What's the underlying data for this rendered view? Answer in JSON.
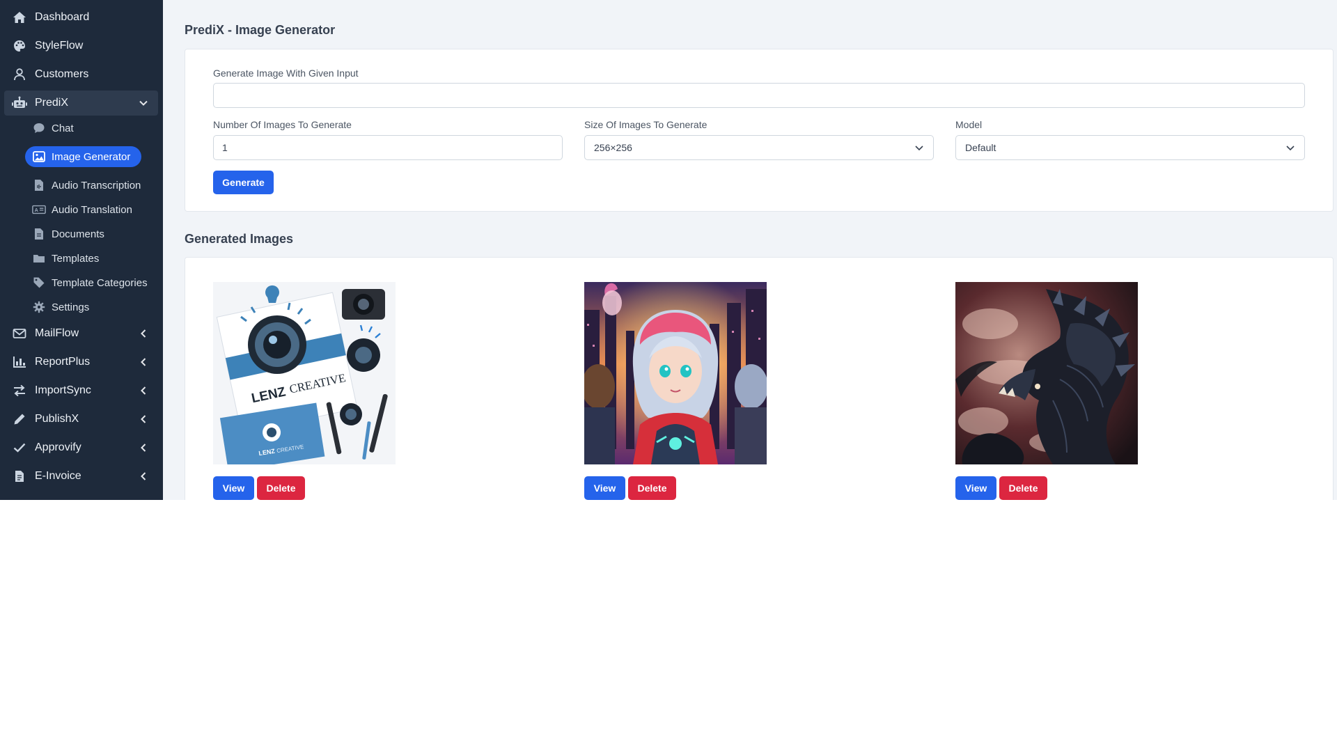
{
  "sidebar": {
    "top_items": [
      {
        "label": "Dashboard",
        "icon": "home-icon"
      },
      {
        "label": "StyleFlow",
        "icon": "palette-icon"
      },
      {
        "label": "Customers",
        "icon": "user-icon"
      },
      {
        "label": "PrediX",
        "icon": "robot-icon"
      }
    ],
    "sub_items": [
      {
        "label": "Chat",
        "icon": "chat-icon"
      },
      {
        "label": "Image Generator",
        "icon": "image-icon"
      },
      {
        "label": "Audio Transcription",
        "icon": "audio-file-icon"
      },
      {
        "label": "Audio Translation",
        "icon": "translate-icon"
      },
      {
        "label": "Documents",
        "icon": "document-icon"
      },
      {
        "label": "Templates",
        "icon": "folder-icon"
      },
      {
        "label": "Template Categories",
        "icon": "tag-icon"
      },
      {
        "label": "Settings",
        "icon": "gear-icon"
      }
    ],
    "bottom_items": [
      {
        "label": "MailFlow",
        "icon": "envelope-icon"
      },
      {
        "label": "ReportPlus",
        "icon": "bar-chart-icon"
      },
      {
        "label": "ImportSync",
        "icon": "swap-icon"
      },
      {
        "label": "PublishX",
        "icon": "pen-icon"
      },
      {
        "label": "Approvify",
        "icon": "check-icon"
      },
      {
        "label": "E-Invoice",
        "icon": "invoice-icon"
      }
    ]
  },
  "page": {
    "title": "PrediX - Image Generator"
  },
  "form": {
    "prompt_label": "Generate Image With Given Input",
    "prompt_value": "",
    "count_label": "Number Of Images To Generate",
    "count_value": "1",
    "size_label": "Size Of Images To Generate",
    "size_value": "256×256",
    "model_label": "Model",
    "model_value": "Default",
    "generate_label": "Generate"
  },
  "gallery": {
    "title": "Generated Images",
    "view_label": "View",
    "delete_label": "Delete",
    "images": [
      {
        "name": "lenz-creative-branding-image",
        "text": "LENZ CREATIVE"
      },
      {
        "name": "anime-girl-city-image"
      },
      {
        "name": "dragon-artwork-image"
      }
    ]
  },
  "colors": {
    "sidebar_bg": "#1e2a3b",
    "accent": "#2563eb",
    "danger": "#dc2640",
    "main_bg": "#f1f4f8"
  }
}
